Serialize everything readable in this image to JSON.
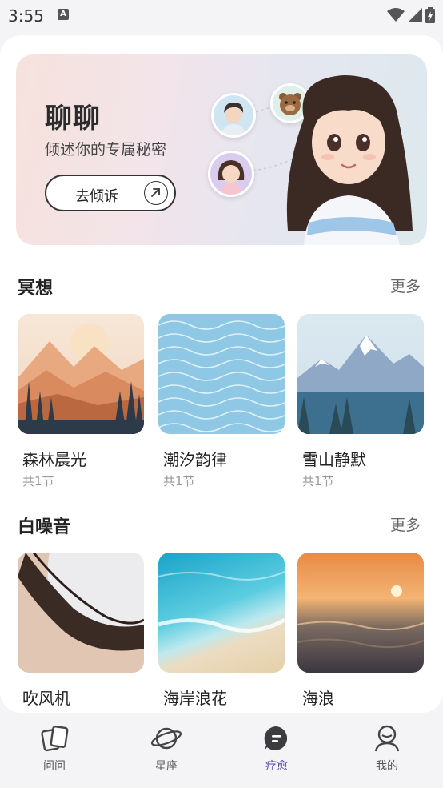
{
  "status": {
    "time": "3:55",
    "notif_letter": "A"
  },
  "banner": {
    "title": "聊聊",
    "subtitle": "倾述你的专属秘密",
    "button_label": "去倾诉"
  },
  "meditation": {
    "title": "冥想",
    "more": "更多",
    "items": [
      {
        "title": "森林晨光",
        "sub": "共1节"
      },
      {
        "title": "潮汐韵律",
        "sub": "共1节"
      },
      {
        "title": "雪山静默",
        "sub": "共1节"
      }
    ]
  },
  "white_noise": {
    "title": "白噪音",
    "more": "更多",
    "items": [
      {
        "title": "吹风机"
      },
      {
        "title": "海岸浪花"
      },
      {
        "title": "海浪"
      }
    ]
  },
  "tabs": [
    {
      "label": "问问",
      "icon": "cards-icon"
    },
    {
      "label": "星座",
      "icon": "planet-icon"
    },
    {
      "label": "疗愈",
      "icon": "chat-bubble-icon",
      "active": true
    },
    {
      "label": "我的",
      "icon": "profile-icon"
    }
  ],
  "colors": {
    "accent": "#5b4bb0"
  }
}
